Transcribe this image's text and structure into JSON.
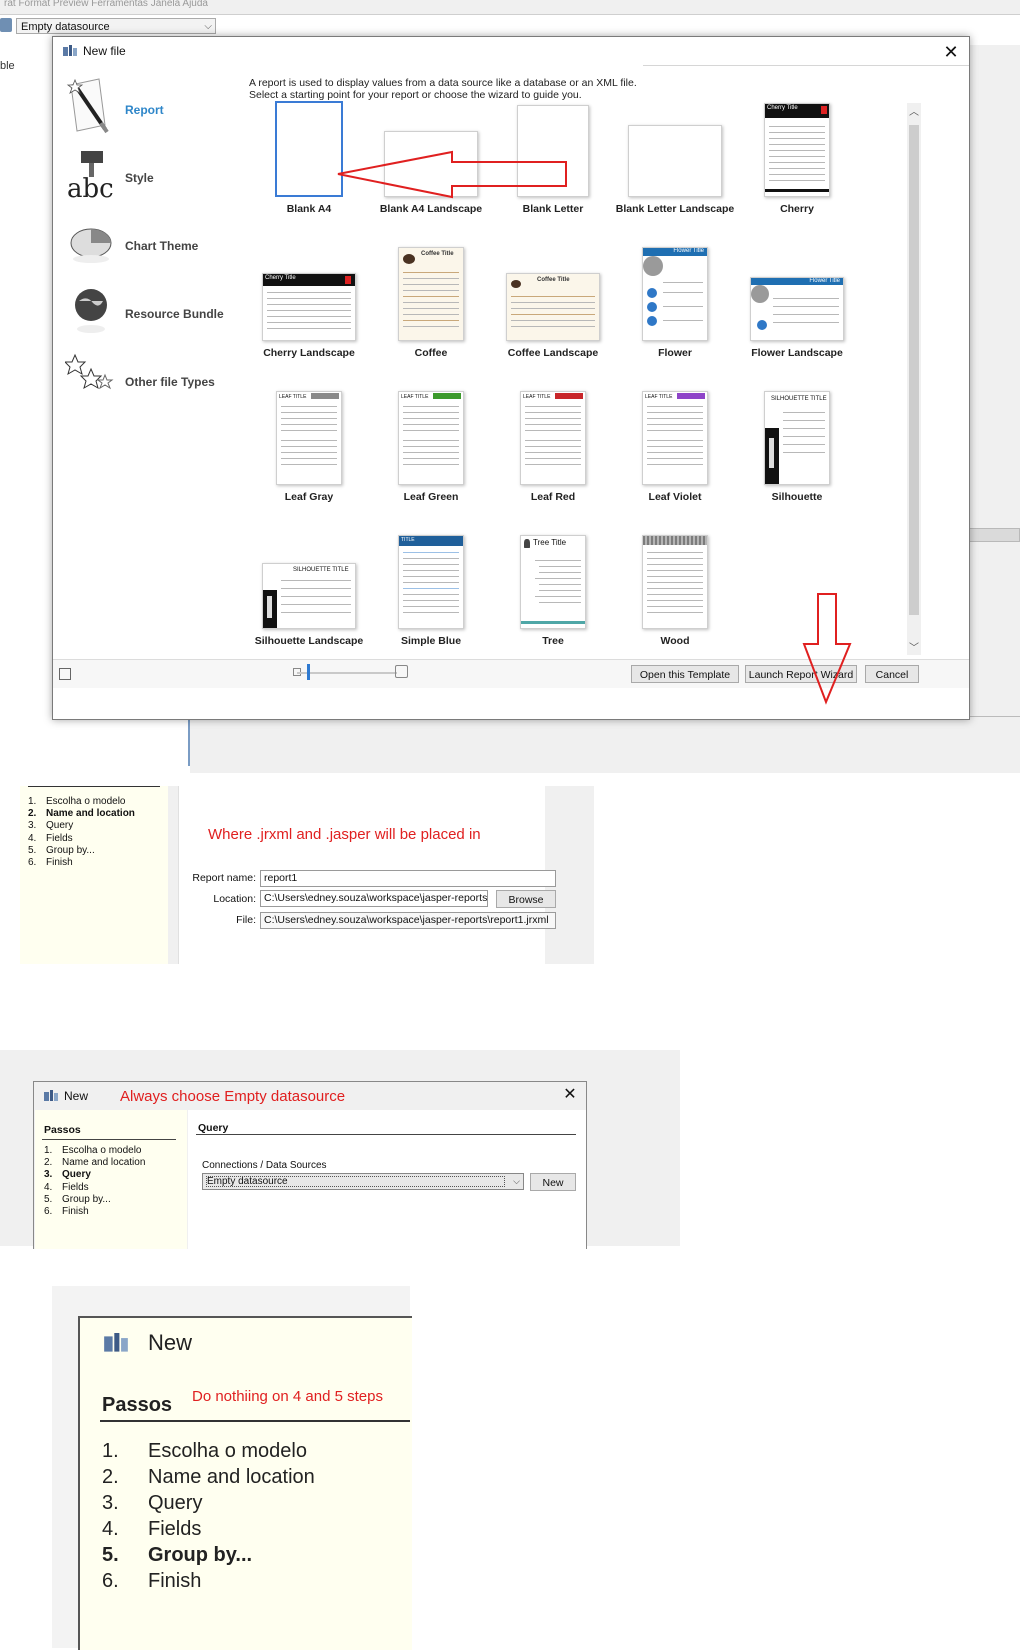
{
  "background_app": {
    "menu_fragment": "rat Format Preview Ferramentas Janela Ajuda",
    "datasource_combo": "Empty datasource",
    "left_fragment": "ble"
  },
  "new_file_dialog": {
    "title": "New file",
    "close_glyph": "✕",
    "categories": [
      {
        "label": "Report",
        "icon": "report-wand-icon",
        "active": true
      },
      {
        "label": "Style",
        "icon": "style-abc-icon",
        "active": false
      },
      {
        "label": "Chart Theme",
        "icon": "pie-chart-icon",
        "active": false
      },
      {
        "label": "Resource Bundle",
        "icon": "globe-icon",
        "active": false
      },
      {
        "label": "Other file Types",
        "icon": "stars-icon",
        "active": false
      }
    ],
    "description": "A report is used to display values from a data source like a database or an XML file.\nSelect a starting point for your report or choose the wizard to guide you.",
    "templates": [
      {
        "name": "Blank A4"
      },
      {
        "name": "Blank A4 Landscape"
      },
      {
        "name": "Blank Letter"
      },
      {
        "name": "Blank Letter Landscape"
      },
      {
        "name": "Cherry"
      },
      {
        "name": "Cherry Landscape"
      },
      {
        "name": "Coffee"
      },
      {
        "name": "Coffee Landscape"
      },
      {
        "name": "Flower"
      },
      {
        "name": "Flower Landscape"
      },
      {
        "name": "Leaf Gray"
      },
      {
        "name": "Leaf Green"
      },
      {
        "name": "Leaf Red"
      },
      {
        "name": "Leaf Violet"
      },
      {
        "name": "Silhouette"
      },
      {
        "name": "Silhouette Landscape"
      },
      {
        "name": "Simple Blue"
      },
      {
        "name": "Tree"
      },
      {
        "name": "Wood"
      }
    ],
    "selected_template": "Blank A4",
    "buttons": {
      "open_template": "Open this Template",
      "launch_wizard": "Launch Report Wizard",
      "cancel": "Cancel"
    },
    "thumb_texts": {
      "cherry": "Cherry Title",
      "coffee": "Coffee Title",
      "flower": "Flower Title",
      "leaf": "LEAF TITLE",
      "silhouette": "SILHOUETTE TITLE",
      "simple_blue": "TITLE",
      "tree": "Tree Title"
    }
  },
  "name_location_step": {
    "steps": [
      {
        "num": "1.",
        "label": "Escolha o modelo",
        "bold": false
      },
      {
        "num": "2.",
        "label": "Name and location",
        "bold": true
      },
      {
        "num": "3.",
        "label": "Query",
        "bold": false
      },
      {
        "num": "4.",
        "label": "Fields",
        "bold": false
      },
      {
        "num": "5.",
        "label": "Group by...",
        "bold": false
      },
      {
        "num": "6.",
        "label": "Finish",
        "bold": false
      }
    ],
    "annotation": "Where .jrxml and .jasper will be placed in",
    "report_name_label": "Report name:",
    "report_name_value": "report1",
    "location_label": "Location:",
    "location_value": "C:\\Users\\edney.souza\\workspace\\jasper-reports",
    "browse_button": "Browse",
    "file_label": "File:",
    "file_value": "C:\\Users\\edney.souza\\workspace\\jasper-reports\\report1.jrxml"
  },
  "query_step": {
    "title": "New",
    "annotation": "Always choose Empty datasource",
    "close_glyph": "✕",
    "steps_title": "Passos",
    "steps": [
      {
        "num": "1.",
        "label": "Escolha o modelo",
        "bold": false
      },
      {
        "num": "2.",
        "label": "Name and location",
        "bold": false
      },
      {
        "num": "3.",
        "label": "Query",
        "bold": true
      },
      {
        "num": "4.",
        "label": "Fields",
        "bold": false
      },
      {
        "num": "5.",
        "label": "Group by...",
        "bold": false
      },
      {
        "num": "6.",
        "label": "Finish",
        "bold": false
      }
    ],
    "section_title": "Query",
    "connections_label": "Connections / Data Sources",
    "connection_value": "Empty datasource",
    "new_button": "New"
  },
  "group_step_zoom": {
    "title": "New",
    "steps_title": "Passos",
    "annotation": "Do nothiing on 4 and 5 steps",
    "steps": [
      {
        "num": "1.",
        "label": "Escolha o modelo",
        "bold": false
      },
      {
        "num": "2.",
        "label": "Name and location",
        "bold": false
      },
      {
        "num": "3.",
        "label": "Query",
        "bold": false
      },
      {
        "num": "4.",
        "label": "Fields",
        "bold": false
      },
      {
        "num": "5.",
        "label": "Group by...",
        "bold": true
      },
      {
        "num": "6.",
        "label": "Finish",
        "bold": false
      }
    ]
  },
  "colors": {
    "annotation_red": "#e02020",
    "active_blue": "#2e86c9",
    "selection_blue": "#3a7bd5",
    "wizard_background": "#fffff0"
  }
}
